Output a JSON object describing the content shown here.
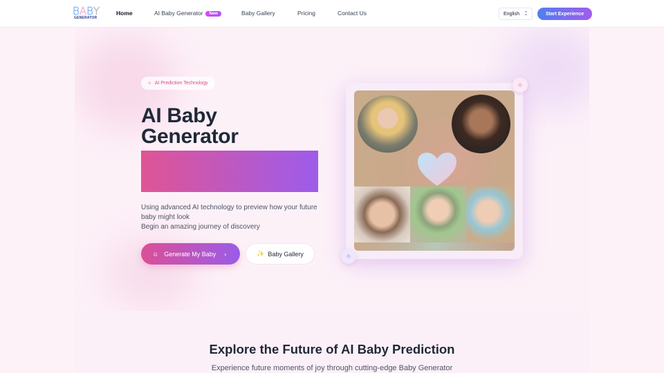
{
  "nav": {
    "logo": {
      "top": "BABY",
      "bottom": "GENERATOR",
      "letter_colors": [
        "#60a5fa",
        "#f9a8d4",
        "#60a5fa",
        "#9ca3af"
      ]
    },
    "links": [
      {
        "label": "Home",
        "active": true
      },
      {
        "label": "AI Baby Generator",
        "badge": "New"
      },
      {
        "label": "Baby Gallery"
      },
      {
        "label": "Pricing"
      },
      {
        "label": "Contact Us"
      }
    ],
    "language": "English",
    "cta": "Start Experience"
  },
  "hero": {
    "badge": {
      "icon": "sparkles-icon",
      "label": "AI Prediction Technology"
    },
    "title_line1": "AI Baby",
    "title_line2": "Generator",
    "description_line1": "Using advanced AI technology to preview how your future baby might look",
    "description_line2": "Begin an amazing journey of discovery",
    "primary_button": {
      "icon": "baby-face-icon",
      "label": "Generate My Baby",
      "trailing_icon": "chevron-right-icon"
    },
    "secondary_button": {
      "icon": "sparkles-icon",
      "label": "Baby Gallery"
    },
    "image": {
      "description": "Collage of a woman and a man portrait, a heart, and three baby photos",
      "parents": [
        "mother-portrait",
        "father-portrait"
      ],
      "babies": [
        "baby-1",
        "baby-2",
        "baby-3"
      ]
    }
  },
  "section2": {
    "title": "Explore the Future of AI Baby Prediction",
    "subtitle": "Experience future moments of joy through cutting-edge Baby Generator"
  },
  "colors": {
    "primary_gradient_start": "#df5595",
    "primary_gradient_end": "#9d5ceb",
    "cta_gradient_start": "#4f7ff0",
    "cta_gradient_end": "#a15cf0",
    "badge_text": "#d6497f",
    "page_bg": "#fdf2f8"
  }
}
